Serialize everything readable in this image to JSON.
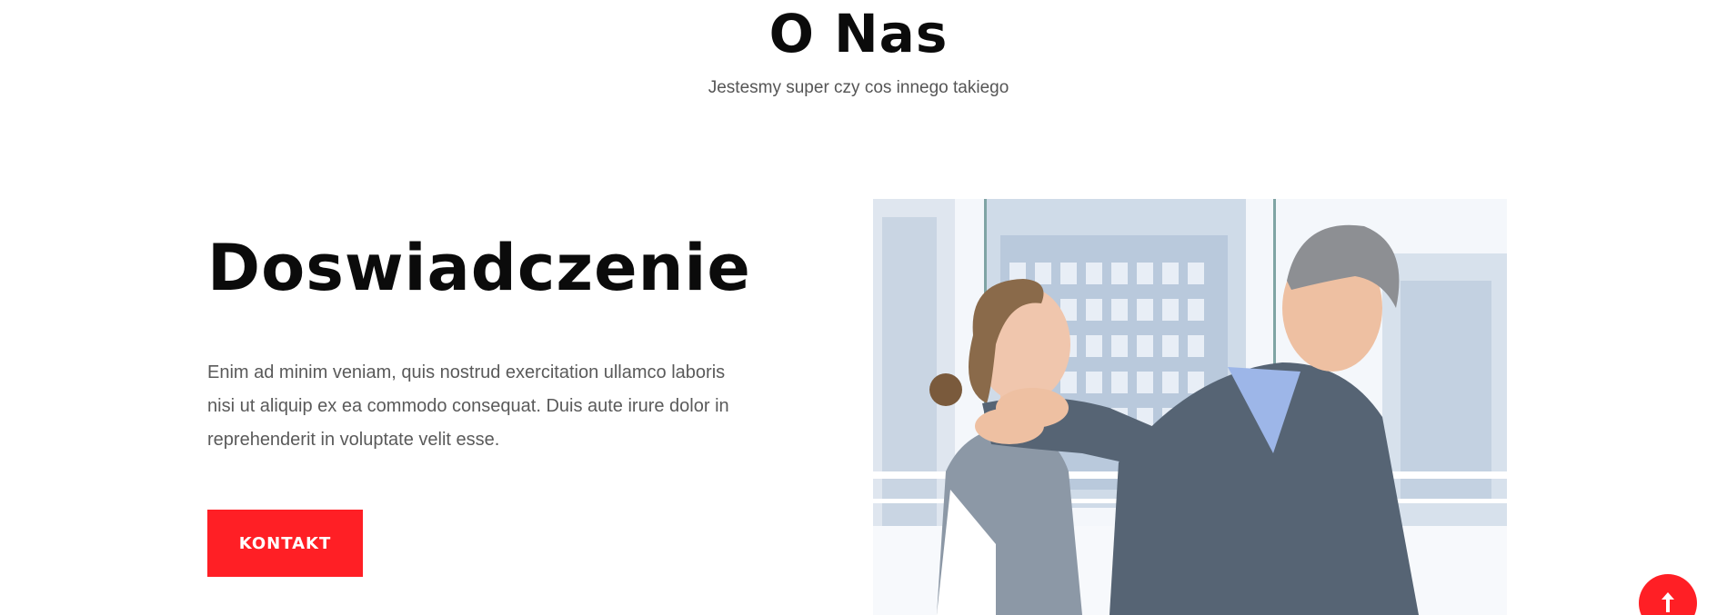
{
  "section": {
    "title": "O Nas",
    "subtitle": "Jestesmy super czy cos innego takiego"
  },
  "feature": {
    "title": "Doswiadczenie",
    "text": "Enim ad minim veniam, quis nostrud exercitation ullamco laboris nisi ut aliquip ex ea commodo consequat. Duis aute irure dolor in reprehenderit in voluptate velit esse.",
    "button_label": "KONTAKT"
  },
  "photo": {
    "icon": "office-photo"
  },
  "scroll_top": {
    "icon": "arrow-up-icon"
  },
  "colors": {
    "accent": "#ff1f25",
    "heading": "#0b0b0b",
    "body_text": "#5a5a5a"
  }
}
